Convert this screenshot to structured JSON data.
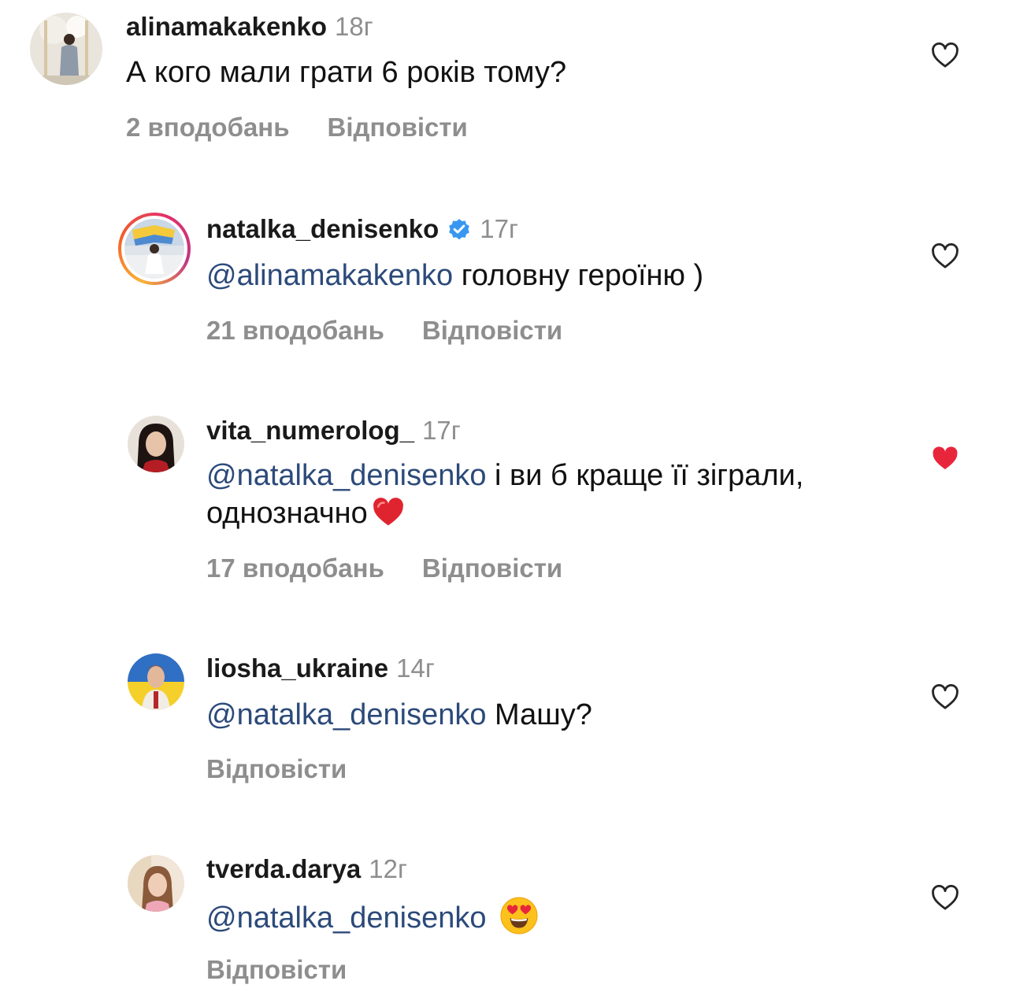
{
  "comments": [
    {
      "username": "alinamakakenko",
      "time": "18г",
      "text": "А кого мали грати 6 років тому?",
      "likes": "2 вподобань",
      "reply": "Відповісти",
      "liked": false,
      "avatar_icon": "avatar-photo"
    },
    {
      "username": "natalka_denisenko",
      "verified": true,
      "time": "17г",
      "mention": "@alinamakakenko",
      "text": " головну героїню )",
      "likes": "21 вподобань",
      "reply": "Відповісти",
      "liked": false,
      "avatar_icon": "avatar-photo-story-ring"
    },
    {
      "username": "vita_numerolog_",
      "time": "17г",
      "mention": "@natalka_denisenko",
      "text": " і ви б краще її зіграли, однозначно",
      "emoji": "red-heart-emoji",
      "likes": "17 вподобань",
      "reply": "Відповісти",
      "liked": true,
      "avatar_icon": "avatar-photo"
    },
    {
      "username": "liosha_ukraine",
      "time": "14г",
      "mention": "@natalka_denisenko",
      "text": " Машу?",
      "reply": "Відповісти",
      "liked": false,
      "avatar_icon": "avatar-photo"
    },
    {
      "username": "tverda.darya",
      "time": "12г",
      "mention": "@natalka_denisenko",
      "text": "",
      "emoji": "heart-eyes-emoji",
      "reply": "Відповісти",
      "liked": false,
      "avatar_icon": "avatar-photo"
    }
  ],
  "colors": {
    "mention": "#2c4a7a",
    "muted": "#8e8e8e",
    "liked_heart": "#e8263b",
    "verified": "#3897f0"
  }
}
